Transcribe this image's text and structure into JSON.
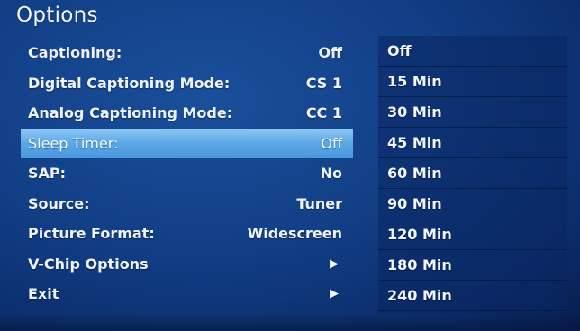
{
  "title": "Options",
  "menu": {
    "items": [
      {
        "label": "Captioning:",
        "value": "Off"
      },
      {
        "label": "Digital Captioning Mode:",
        "value": "CS 1"
      },
      {
        "label": "Analog Captioning Mode:",
        "value": "CC 1"
      },
      {
        "label": "Sleep Timer:",
        "value": "Off"
      },
      {
        "label": "SAP:",
        "value": "No"
      },
      {
        "label": "Source:",
        "value": "Tuner"
      },
      {
        "label": "Picture Format:",
        "value": "Widescreen"
      },
      {
        "label": "V-Chip Options",
        "value": "▶"
      },
      {
        "label": "Exit",
        "value": "▶"
      }
    ]
  },
  "submenu": {
    "options": [
      "Off",
      "15 Min",
      "30 Min",
      "45 Min",
      "60 Min",
      "90 Min",
      "120 Min",
      "180 Min",
      "240 Min"
    ]
  },
  "colors": {
    "background": "#123f86",
    "selected_highlight": "#5aa7e6"
  }
}
